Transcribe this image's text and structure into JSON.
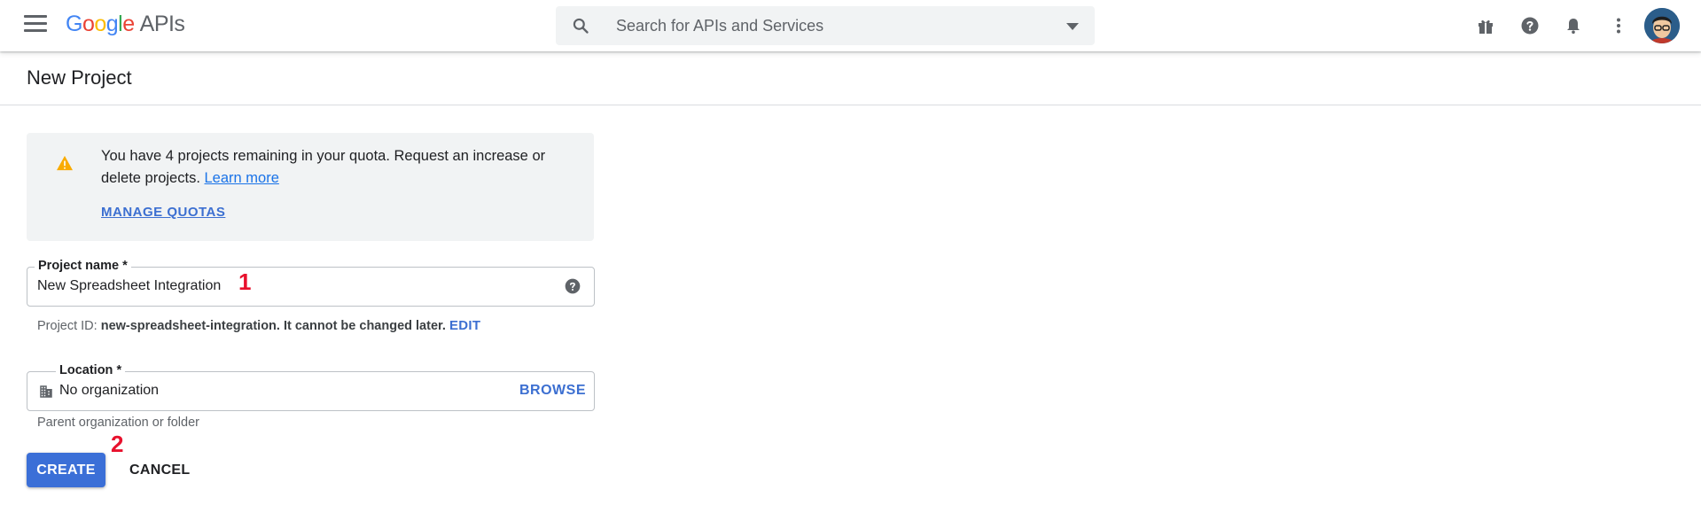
{
  "header": {
    "logo_letters": [
      "G",
      "o",
      "o",
      "g",
      "l",
      "e"
    ],
    "product": "APIs",
    "search_placeholder": "Search for APIs and Services",
    "icons": [
      "menu-icon",
      "search-icon",
      "dropdown-caret-icon",
      "gift-icon",
      "help-icon",
      "bell-icon",
      "more-vert-icon",
      "avatar"
    ]
  },
  "page": {
    "title": "New Project"
  },
  "notice": {
    "message": "You have 4 projects remaining in your quota. Request an increase or delete projects.",
    "learn_more": "Learn more",
    "manage_quotas": "MANAGE QUOTAS",
    "icon": "warning-icon",
    "icon_color": "#f9ab00"
  },
  "project_name": {
    "label": "Project name *",
    "value": "New Spreadsheet Integration",
    "annotation": "1"
  },
  "project_id": {
    "prefix": "Project ID:",
    "id": "new-spreadsheet-integration.",
    "suffix": "It cannot be changed later.",
    "edit": "EDIT"
  },
  "location": {
    "label": "Location *",
    "value": "No organization",
    "browse": "BROWSE",
    "hint": "Parent organization or folder",
    "icon": "building-icon"
  },
  "actions": {
    "annotation": "2",
    "create": "CREATE",
    "cancel": "CANCEL"
  },
  "colors": {
    "primary": "#3b6fd7",
    "annotation": "#e8112d",
    "warning": "#f9ab00"
  }
}
